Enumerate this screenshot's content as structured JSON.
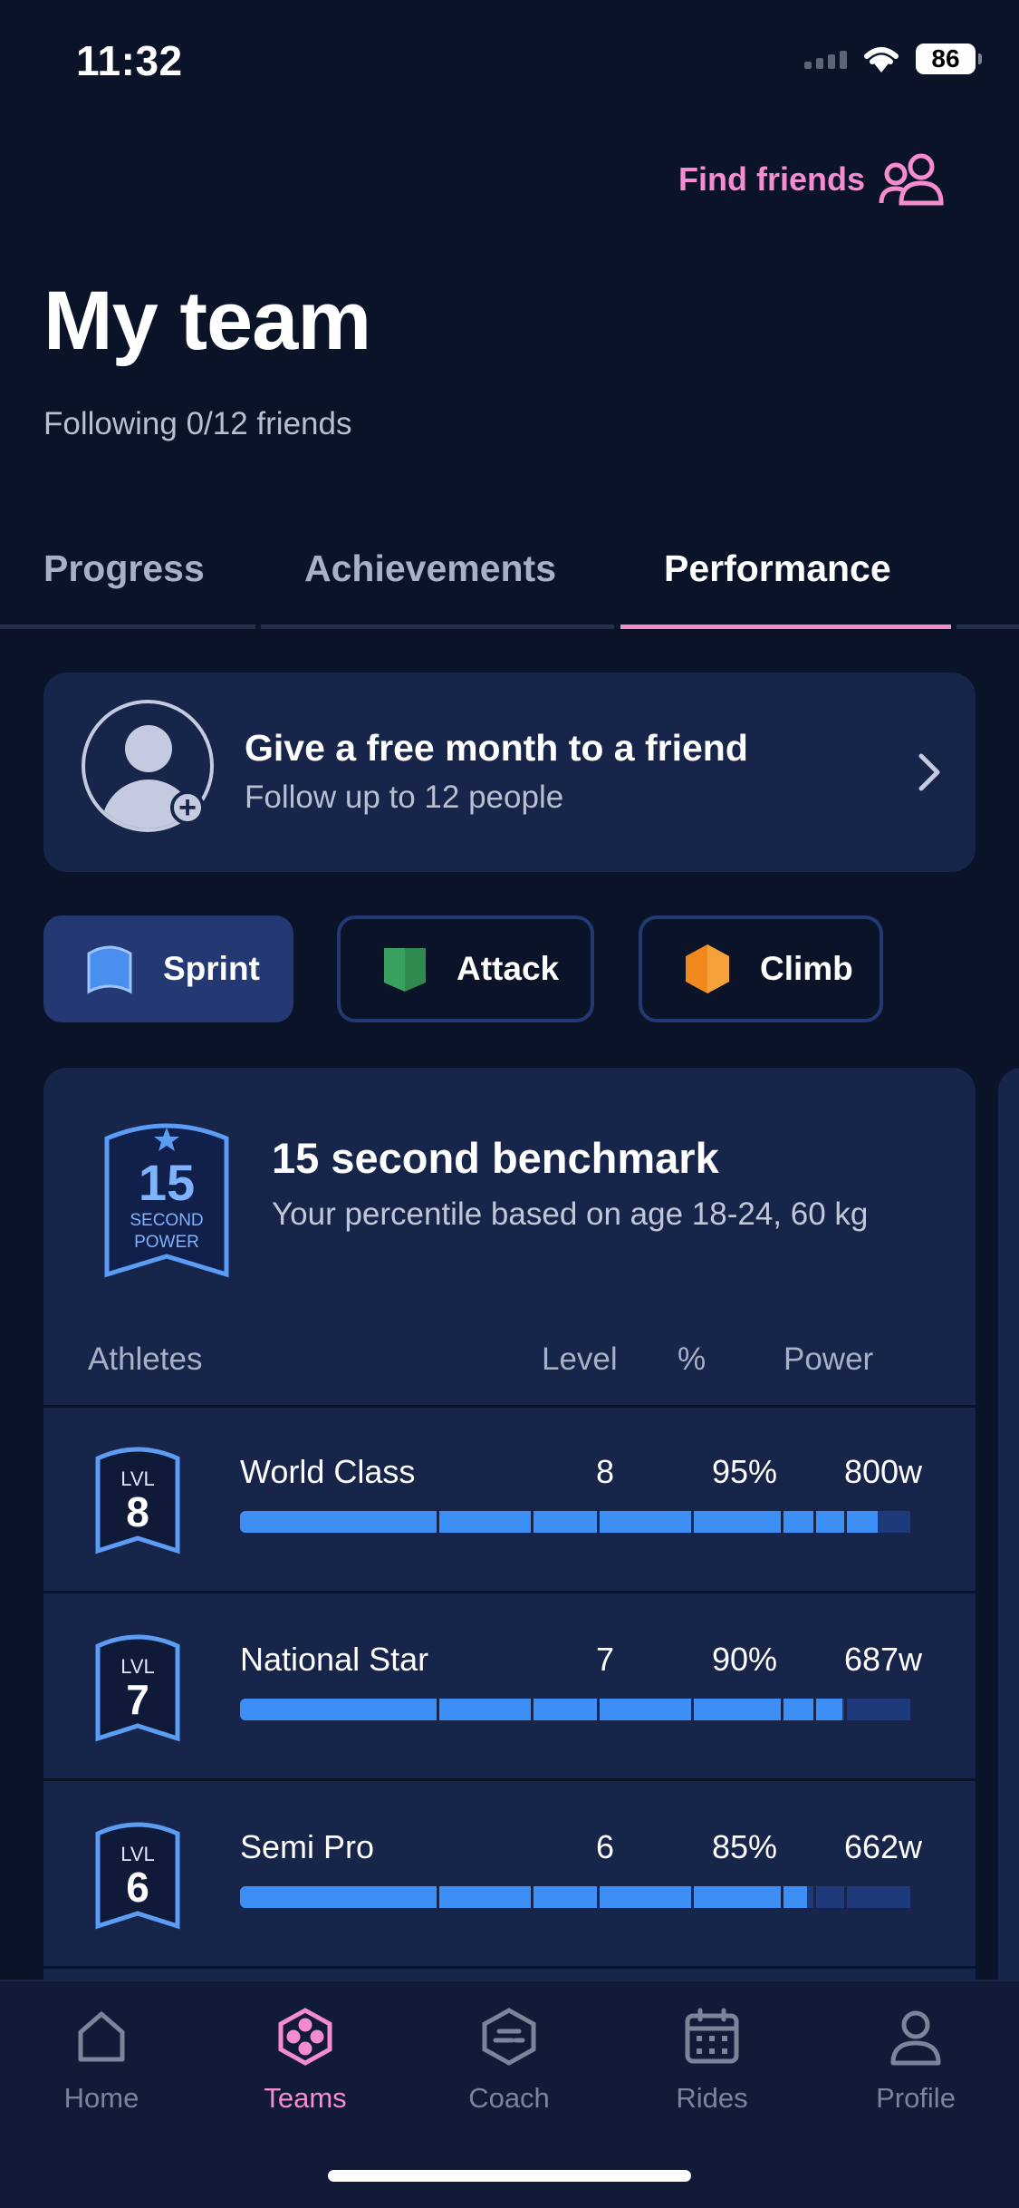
{
  "status_bar": {
    "time": "11:32",
    "battery": "86"
  },
  "header": {
    "find_friends_label": "Find friends",
    "title": "My team",
    "subtitle": "Following 0/12 friends"
  },
  "tabs": [
    {
      "label": "Progress",
      "active": false
    },
    {
      "label": "Achievements",
      "active": false
    },
    {
      "label": "Performance",
      "active": true
    }
  ],
  "referral": {
    "title": "Give a free month to a friend",
    "subtitle": "Follow up to 12 people"
  },
  "filters": [
    {
      "label": "Sprint",
      "active": true,
      "icon": "sprint-shield-icon",
      "color": "#4a8ff0"
    },
    {
      "label": "Attack",
      "active": false,
      "icon": "attack-shield-icon",
      "color": "#2f8a4f"
    },
    {
      "label": "Climb",
      "active": false,
      "icon": "climb-hexagon-icon",
      "color": "#f08a1e"
    }
  ],
  "benchmark": {
    "badge": {
      "number": "15",
      "line1": "SECOND",
      "line2": "POWER"
    },
    "title": "15 second benchmark",
    "description": " Your percentile based on age 18-24, 60 kg",
    "columns": {
      "athletes": "Athletes",
      "level": "Level",
      "percent": "%",
      "power": "Power"
    },
    "rows": [
      {
        "badge_prefix": "LVL",
        "badge_level": "8",
        "name": "World Class",
        "level": "8",
        "percent": "95%",
        "power": "800w",
        "fill": 0.95
      },
      {
        "badge_prefix": "LVL",
        "badge_level": "7",
        "name": "National Star",
        "level": "7",
        "percent": "90%",
        "power": "687w",
        "fill": 0.9
      },
      {
        "badge_prefix": "LVL",
        "badge_level": "6",
        "name": "Semi Pro",
        "level": "6",
        "percent": "85%",
        "power": "662w",
        "fill": 0.85
      }
    ]
  },
  "bottom_nav": [
    {
      "label": "Home",
      "icon": "home-icon",
      "active": false
    },
    {
      "label": "Teams",
      "icon": "teams-icon",
      "active": true
    },
    {
      "label": "Coach",
      "icon": "coach-icon",
      "active": false
    },
    {
      "label": "Rides",
      "icon": "calendar-icon",
      "active": false
    },
    {
      "label": "Profile",
      "icon": "profile-icon",
      "active": false
    }
  ],
  "colors": {
    "accent": "#f58ccf",
    "background": "#0b1328",
    "card": "#18254a",
    "bar_fill": "#3d8ff5"
  }
}
